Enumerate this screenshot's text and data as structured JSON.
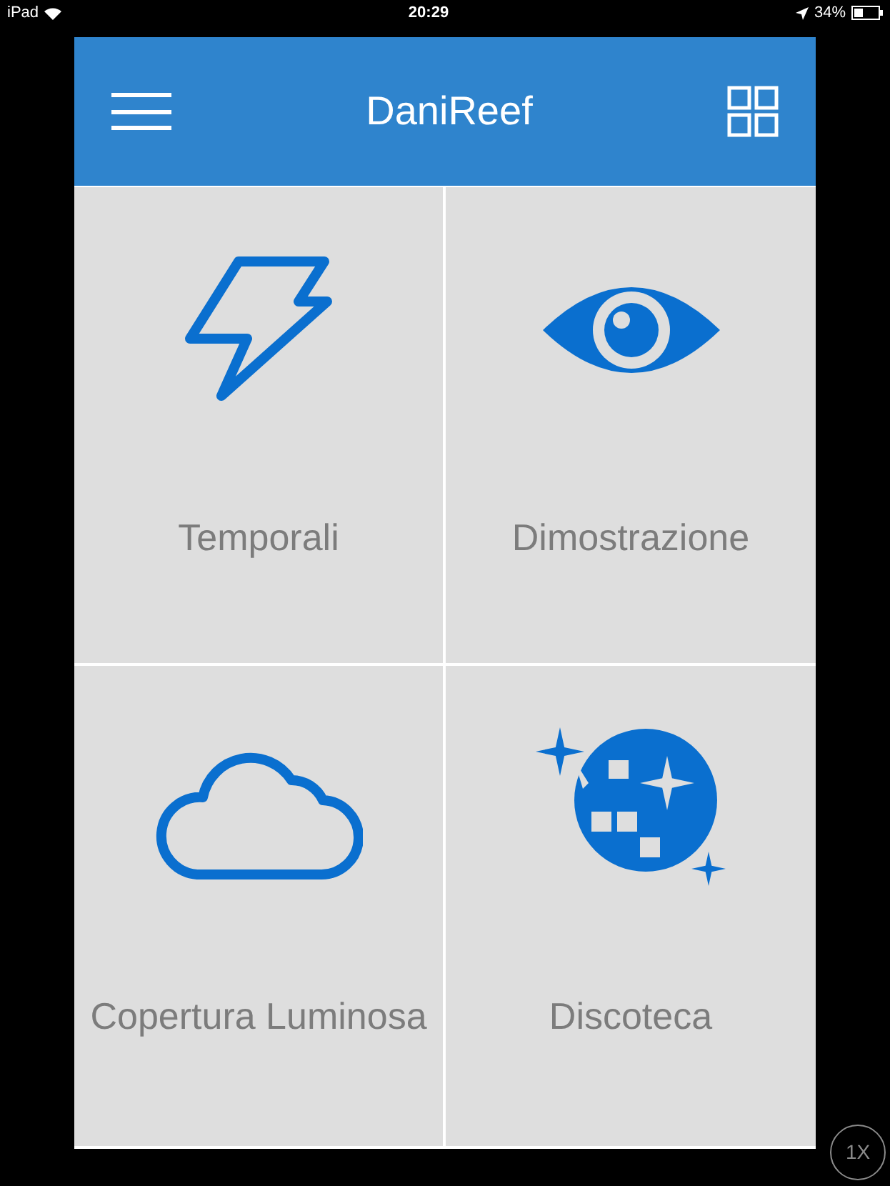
{
  "status_bar": {
    "device": "iPad",
    "time": "20:29",
    "battery": "34%"
  },
  "header": {
    "title": "DaniReef"
  },
  "tiles": [
    {
      "label": "Temporali",
      "kind": "bolt"
    },
    {
      "label": "Dimostrazione",
      "kind": "eye"
    },
    {
      "label": "Copertura Luminosa",
      "kind": "cloud"
    },
    {
      "label": "Discoteca",
      "kind": "disco"
    }
  ],
  "zoom_badge": "1X"
}
